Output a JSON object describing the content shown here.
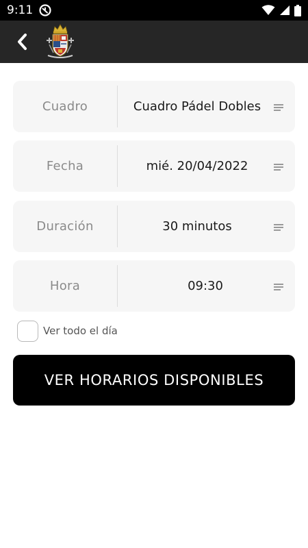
{
  "status_bar": {
    "time": "9:11",
    "icons": [
      "vpn-key-icon",
      "wifi-icon",
      "cellular-signal-icon",
      "battery-icon"
    ]
  },
  "app_bar": {
    "back_icon": "chevron-left-icon",
    "logo": "coat-of-arms-logo"
  },
  "form": {
    "rows": [
      {
        "label": "Cuadro",
        "value": "Cuadro Pádel Dobles"
      },
      {
        "label": "Fecha",
        "value": "mié. 20/04/2022"
      },
      {
        "label": "Duración",
        "value": "30 minutos"
      },
      {
        "label": "Hora",
        "value": "09:30"
      }
    ],
    "checkbox": {
      "label": "Ver todo el día",
      "checked": false
    },
    "submit_label": "VER HORARIOS DISPONIBLES"
  },
  "colors": {
    "app_bar": "#262626",
    "row_background": "#f6f6f6",
    "button": "#000000"
  }
}
